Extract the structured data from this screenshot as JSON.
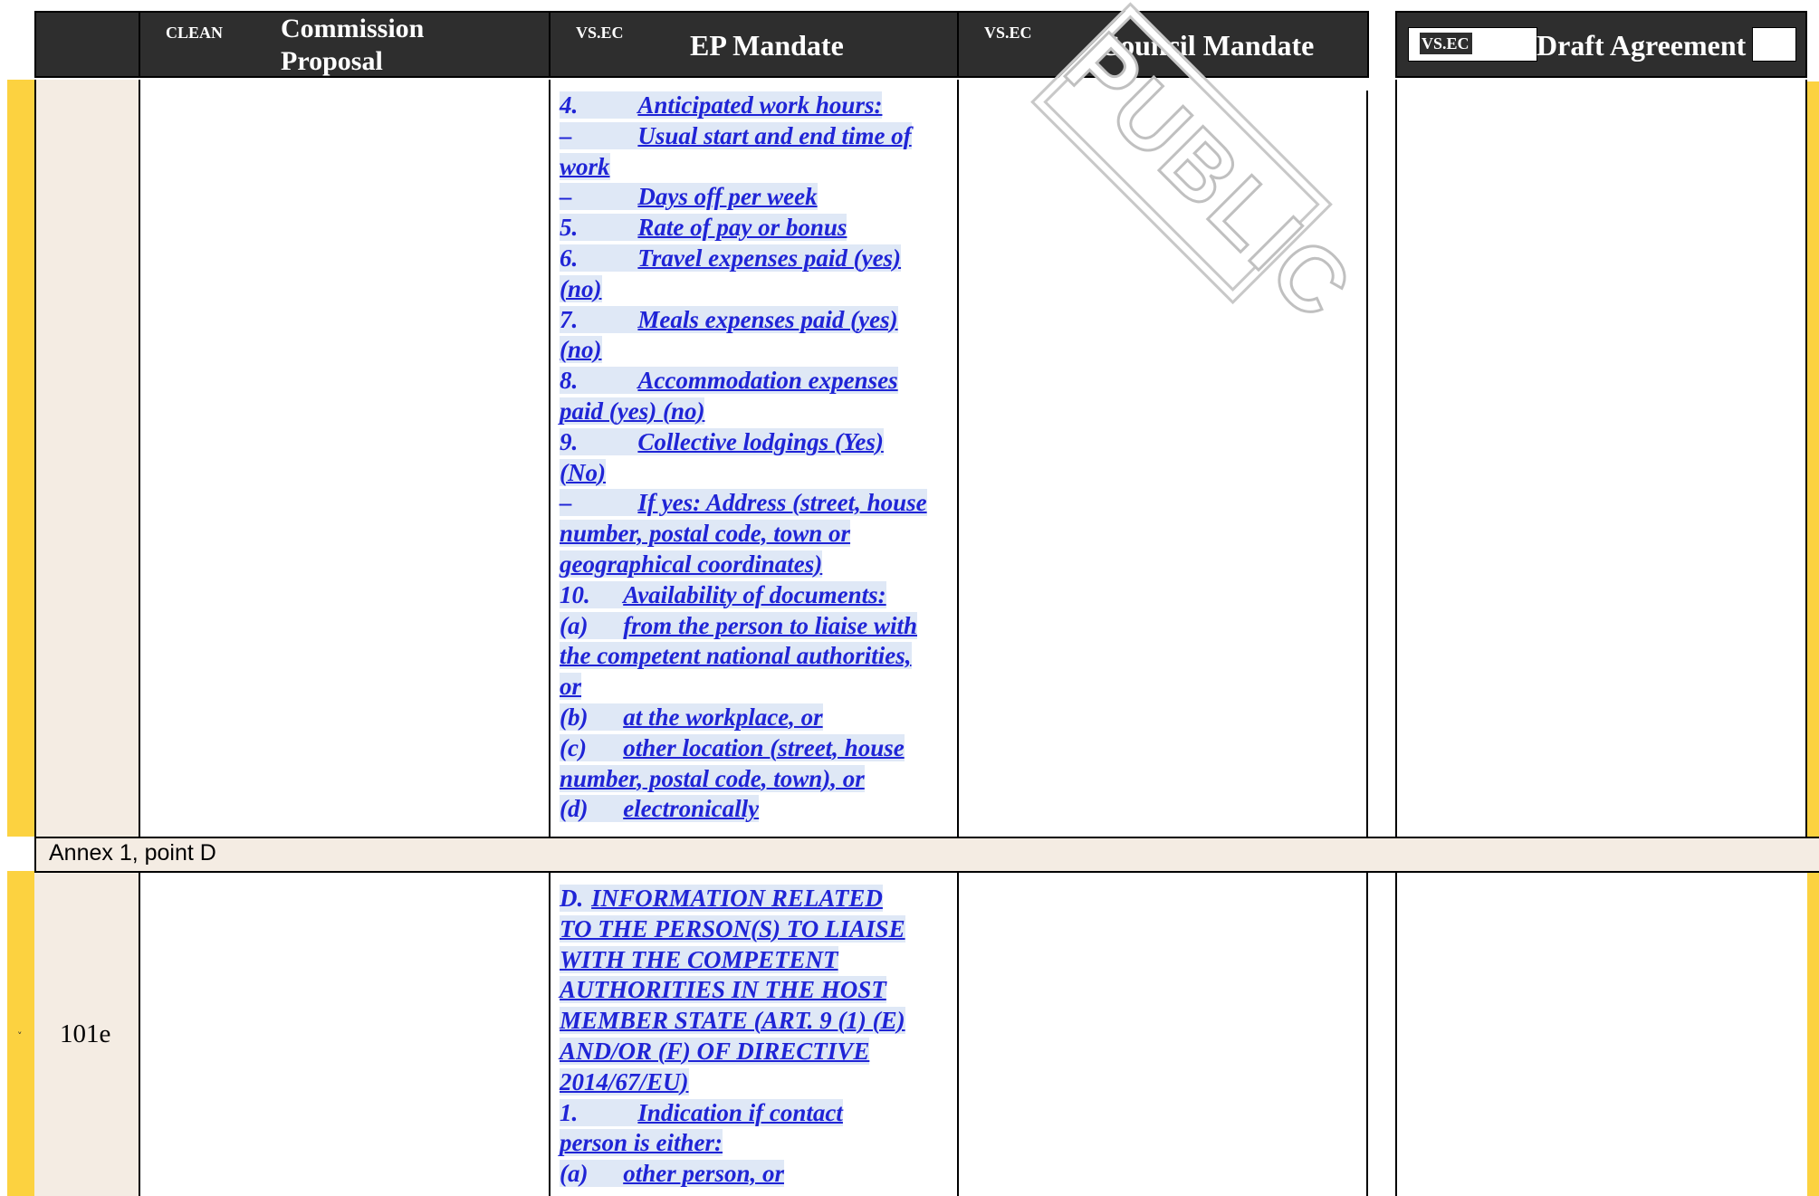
{
  "header": {
    "col_clean_tag": "CLEAN",
    "commission_title_l1": "Commission",
    "commission_title_l2": "Proposal",
    "ep_tag": "VS.EC",
    "ep_title": "EP Mandate",
    "council_tag": "VS.EC",
    "council_title": "Council Mandate",
    "draft_tag": "VS.EC",
    "draft_title": "Draft Agreement"
  },
  "watermark": "PUBLIC",
  "row1": {
    "ep_lines": [
      {
        "n": "4.",
        "t": "Anticipated work hours:"
      },
      {
        "n": "–",
        "t": "Usual start and end time of"
      },
      {
        "n": "",
        "t": "work"
      },
      {
        "n": "–",
        "t": "Days off per week"
      },
      {
        "n": "5.",
        "t": "Rate of pay or bonus"
      },
      {
        "n": "6.",
        "t": "Travel expenses paid (yes)"
      },
      {
        "n": "",
        "t": "(no)"
      },
      {
        "n": "7.",
        "t": "Meals expenses paid (yes)"
      },
      {
        "n": "",
        "t": "(no)"
      },
      {
        "n": "8.",
        "t": "Accommodation expenses"
      },
      {
        "n": "",
        "t": "paid (yes) (no)"
      },
      {
        "n": "9.",
        "t": "Collective lodgings (Yes)"
      },
      {
        "n": "",
        "t": "(No)"
      },
      {
        "n": "–",
        "t": "If yes: Address (street, house"
      },
      {
        "n": "",
        "t": "number, postal code, town or"
      },
      {
        "n": "",
        "t": "geographical coordinates)"
      },
      {
        "n": "10.",
        "t": "Availability of documents:"
      },
      {
        "n": "(a)",
        "t": "from the person to liaise with"
      },
      {
        "n": "",
        "t": "the competent national authorities,"
      },
      {
        "n": "",
        "t": "or"
      },
      {
        "n": "(b)",
        "t": "at the workplace, or"
      },
      {
        "n": "(c)",
        "t": "other location (street, house"
      },
      {
        "n": "",
        "t": "number, postal code, town), or"
      },
      {
        "n": "(d)",
        "t": "electronically"
      }
    ]
  },
  "annex_label": "Annex 1, point D",
  "row2": {
    "row_number": "101e",
    "expand_glyph": "˅",
    "ep_lines": [
      {
        "n": "D.",
        "t": "INFORMATION RELATED"
      },
      {
        "n": "",
        "t": "TO THE PERSON(S) TO LIAISE"
      },
      {
        "n": "",
        "t": "WITH THE COMPETENT"
      },
      {
        "n": "",
        "t": "AUTHORITIES IN THE HOST"
      },
      {
        "n": "",
        "t": "MEMBER STATE (ART. 9 (1) (E)"
      },
      {
        "n": "",
        "t": "AND/OR (F) OF DIRECTIVE"
      },
      {
        "n": "",
        "t": "2014/67/EU)"
      },
      {
        "n": "1.",
        "t": "Indication if contact"
      },
      {
        "n": "",
        "t": "person is either:"
      },
      {
        "n": "(a)",
        "t": "other person, or"
      }
    ]
  }
}
